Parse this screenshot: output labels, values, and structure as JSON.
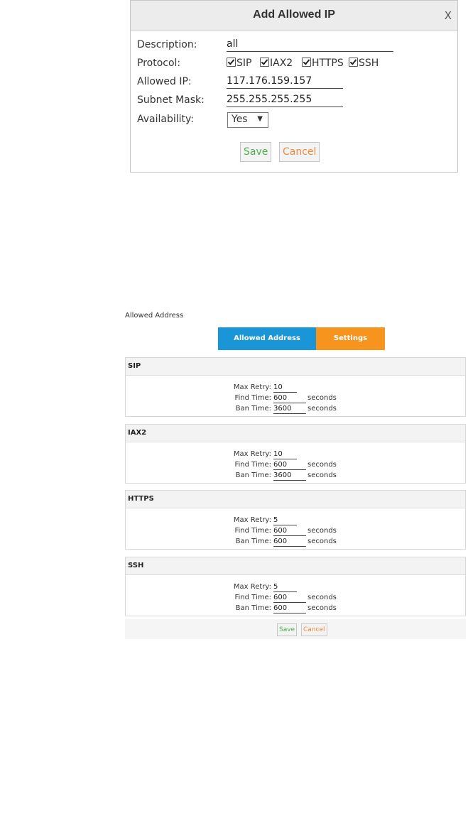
{
  "dialog": {
    "title": "Add Allowed IP",
    "close": "X",
    "description_label": "Description:",
    "description_value": "all",
    "protocol_label": "Protocol:",
    "protocols": [
      "SIP",
      "IAX2",
      "HTTPS",
      "SSH"
    ],
    "allowed_ip_label": "Allowed IP:",
    "allowed_ip_value": "117.176.159.157",
    "subnet_label": "Subnet Mask:",
    "subnet_value": "255.255.255.255",
    "availability_label": "Availability:",
    "availability_value": "Yes",
    "save": "Save",
    "cancel": "Cancel"
  },
  "panel": {
    "page_label": "Allowed Address",
    "tabs": [
      "Allowed Address",
      "Settings"
    ],
    "labels": {
      "max_retry": "Max Retry:",
      "find_time": "Find Time:",
      "ban_time": "Ban Time:",
      "seconds": "seconds"
    },
    "sections": [
      {
        "name": "SIP",
        "max_retry": "10",
        "find_time": "600",
        "ban_time": "3600"
      },
      {
        "name": "IAX2",
        "max_retry": "10",
        "find_time": "600",
        "ban_time": "3600"
      },
      {
        "name": "HTTPS",
        "max_retry": "5",
        "find_time": "600",
        "ban_time": "600"
      },
      {
        "name": "SSH",
        "max_retry": "5",
        "find_time": "600",
        "ban_time": "600"
      }
    ],
    "save": "Save",
    "cancel": "Cancel"
  },
  "colors": {
    "tab_active": "#1a96d8",
    "tab_settings": "#f7941e",
    "save_text": "#4caf50",
    "cancel_text": "#f0883e"
  }
}
